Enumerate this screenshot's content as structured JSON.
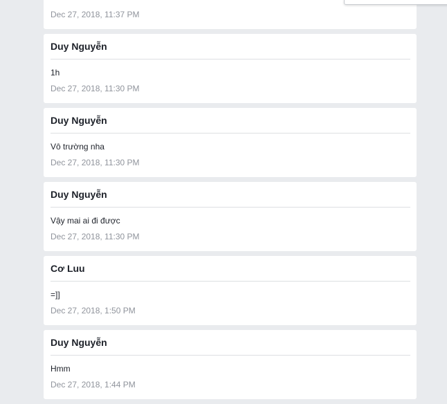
{
  "colors": {
    "background": "#e9ebee",
    "card": "#ffffff",
    "author_text": "#1d2129",
    "timestamp_text": "#90949c",
    "divider": "#dddfe2"
  },
  "comments": [
    {
      "timestamp": "Dec 27, 2018, 11:37 PM"
    },
    {
      "author": "Duy Nguyễn",
      "message": "1h",
      "timestamp": "Dec 27, 2018, 11:30 PM"
    },
    {
      "author": "Duy Nguyễn",
      "message": "Vô trường nha",
      "timestamp": "Dec 27, 2018, 11:30 PM"
    },
    {
      "author": "Duy Nguyễn",
      "message": "Vậy mai ai đi được",
      "timestamp": "Dec 27, 2018, 11:30 PM"
    },
    {
      "author": "Cơ Luu",
      "message": "=]]",
      "timestamp": "Dec 27, 2018, 1:50 PM"
    },
    {
      "author": "Duy Nguyễn",
      "message": "Hmm",
      "timestamp": "Dec 27, 2018, 1:44 PM"
    }
  ]
}
